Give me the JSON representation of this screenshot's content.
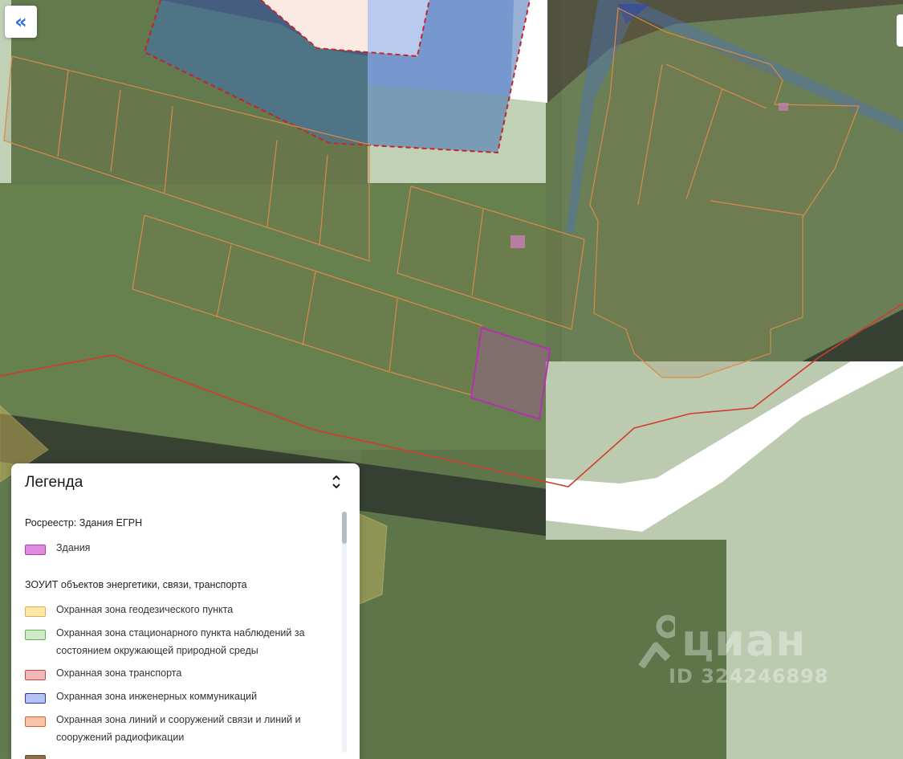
{
  "colors": {
    "accent": "#2f6fd6",
    "buildings": "#e08be0",
    "geodetic": "#fde6a8",
    "environment": "#cdebc6",
    "transport": "#f4b7b7",
    "utilities": "#b6c2f4",
    "communications": "#f7c4aa"
  },
  "nav": {
    "collapse_icon": "double-chevron-left-icon",
    "collapse_glyph": "«"
  },
  "watermark": {
    "brand": "циан",
    "id_text": "ID 324246898"
  },
  "legend": {
    "title": "Легенда",
    "toggle_icon": "collapse-toggle-icon",
    "sections": [
      {
        "title": "Росреестр: Здания ЕГРН",
        "items": [
          {
            "label": "Здания",
            "color": "#e08be0"
          }
        ]
      },
      {
        "title": "ЗОУИТ объектов энергетики, связи, транспорта",
        "items": [
          {
            "label": "Охранная зона геодезического пункта",
            "color": "#fde6a8"
          },
          {
            "label": "Охранная зона стационарного пункта наблюдений за состоянием окружающей природной среды",
            "color": "#cdebc6"
          },
          {
            "label": "Охранная зона транспорта",
            "color": "#f4b7b7"
          },
          {
            "label": "Охранная зона инженерных коммуникаций",
            "color": "#b6c2f4"
          },
          {
            "label": "Охранная зона линий и сооружений связи и линий и сооружений радиофикации",
            "color": "#f7c4aa"
          }
        ]
      }
    ]
  }
}
